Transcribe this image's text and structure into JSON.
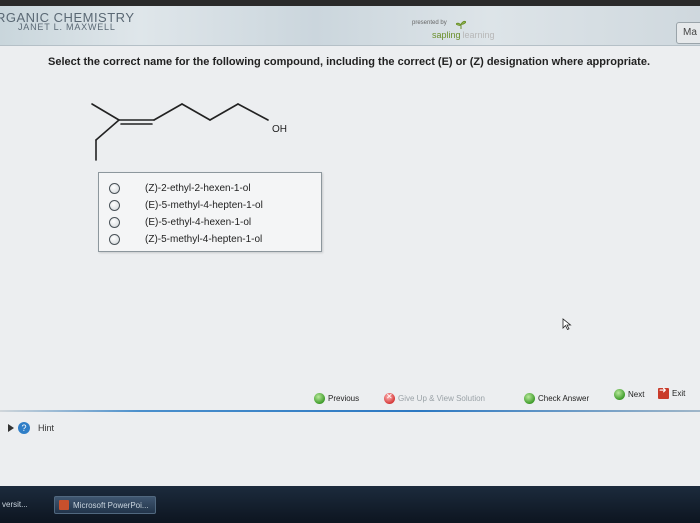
{
  "header": {
    "course_title": "RGANIC CHEMISTRY",
    "course_author": "JANET L. MAXWELL",
    "presented_by": "presented by",
    "brand_primary": "sapling",
    "brand_secondary": "learning",
    "corner_button": "Ma"
  },
  "question": {
    "prompt": "Select the correct name for the following compound, including the correct (E) or (Z) designation where appropriate.",
    "structure_label": "OH"
  },
  "options": [
    {
      "label": "(Z)-2-ethyl-2-hexen-1-ol"
    },
    {
      "label": "(E)-5-methyl-4-hepten-1-ol"
    },
    {
      "label": "(E)-5-ethyl-4-hexen-1-ol"
    },
    {
      "label": "(Z)-5-methyl-4-hepten-1-ol"
    }
  ],
  "navigation": {
    "previous": "Previous",
    "give_up": "Give Up & View Solution",
    "check_answer": "Check Answer",
    "next": "Next",
    "exit": "Exit"
  },
  "hint": {
    "label": "Hint"
  },
  "taskbar": {
    "item_1": "versit...",
    "item_2": "Microsoft PowerPoi..."
  },
  "colors": {
    "accent_blue": "#2c78c2",
    "brand_green": "#6a8f2a",
    "button_green": "#3f9c2b",
    "button_red": "#d63a3a"
  }
}
